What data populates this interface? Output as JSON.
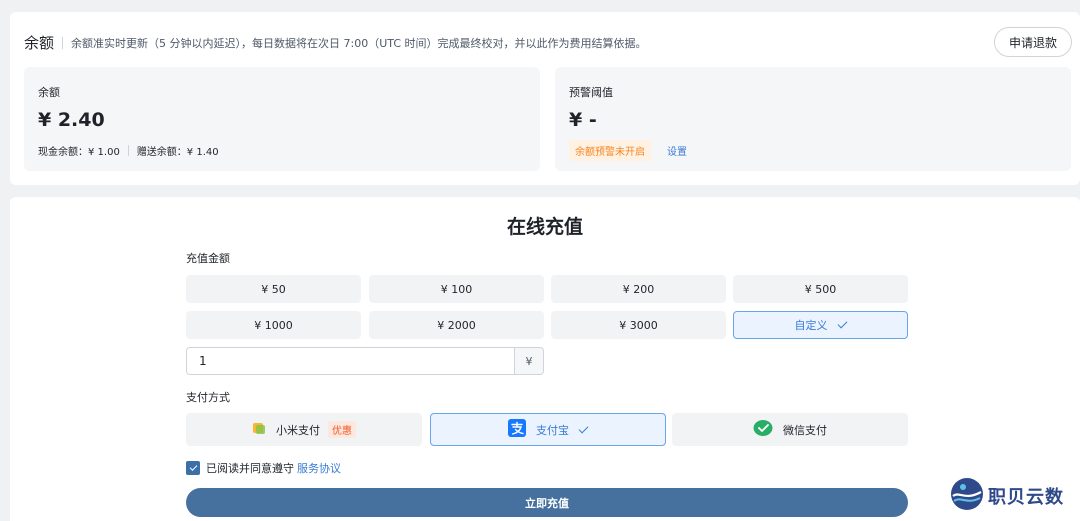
{
  "header": {
    "title": "余额",
    "description": "余额准实时更新（5 分钟以内延迟），每日数据将在次日 7:00（UTC 时间）完成最终校对，并以此作为费用结算依据。",
    "refund_button": "申请退款"
  },
  "balance": {
    "label": "余额",
    "value": "¥ 2.40",
    "cash": "现金余额：¥ 1.00",
    "gift": "赠送余额：¥ 1.40"
  },
  "threshold": {
    "label": "预警阈值",
    "value": "¥ -",
    "status_tag": "余额预警未开启",
    "settings_link": "设置"
  },
  "recharge": {
    "title": "在线充值",
    "amount_label": "充值金额",
    "amounts": [
      "¥ 50",
      "¥ 100",
      "¥ 200",
      "¥ 500",
      "¥ 1000",
      "¥ 2000",
      "¥ 3000",
      "自定义"
    ],
    "selected_amount": "自定义",
    "custom_value": "1",
    "currency_suffix": "¥",
    "payment_label": "支付方式",
    "payments": [
      "小米支付",
      "支付宝",
      "微信支付"
    ],
    "promo_tag": "优惠",
    "selected_payment": "支付宝",
    "agree_text": "已阅读并同意遵守",
    "agree_link": "服务协议",
    "submit_button": "立即充值"
  },
  "watermark": {
    "text": "职贝云数"
  },
  "colors": {
    "accent": "#3a7bd5",
    "submit": "#46709e",
    "warning": "#f5841f",
    "promo": "#f05a28"
  }
}
